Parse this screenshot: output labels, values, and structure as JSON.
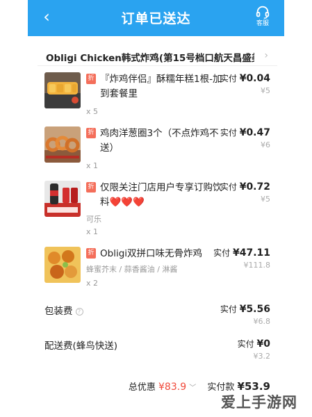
{
  "header": {
    "title": "订单已送达",
    "back_glyph": "‹",
    "service_label": "客服",
    "bg_color": "#2aa3f0"
  },
  "store": {
    "name": "Obligi Chicken韩式炸鸡(第15号档口航天昌盛美...",
    "chevron": "›"
  },
  "items": [
    {
      "discount_tag": "折",
      "name": "『炸鸡伴侣』酥糯年糕1根-加到套餐里",
      "spec": "",
      "qty": "x 5",
      "paid_label": "实付",
      "paid": "¥0.04",
      "original": "¥5"
    },
    {
      "discount_tag": "折",
      "name": "鸡肉洋葱圈3个（不点炸鸡不送）",
      "spec": "",
      "qty": "x 1",
      "paid_label": "实付",
      "paid": "¥0.47",
      "original": "¥6"
    },
    {
      "discount_tag": "折",
      "name": "仅限关注门店用户专享订购饮料❤️❤️❤️",
      "spec": "可乐",
      "qty": "x 1",
      "paid_label": "实付",
      "paid": "¥0.72",
      "original": "¥5"
    },
    {
      "discount_tag": "折",
      "name": "Obligi双拼口味无骨炸鸡",
      "spec": "蜂蜜芥末 / 蒜香酱油 / 淋酱",
      "qty": "x 2",
      "paid_label": "实付",
      "paid": "¥47.11",
      "original": "¥111.8"
    }
  ],
  "fees": [
    {
      "label": "包装费",
      "has_help": true,
      "paid_label": "实付",
      "paid": "¥5.56",
      "original": "¥6.8"
    },
    {
      "label": "配送费(蜂鸟快送)",
      "has_help": false,
      "paid_label": "实付",
      "paid": "¥0",
      "original": "¥3.2"
    }
  ],
  "summary": {
    "discount_label": "总优惠",
    "discount_value": "¥83.9",
    "paid_label": "实付款",
    "paid_value": "¥53.9"
  },
  "watermark": "爱上手游网",
  "colors": {
    "header": "#2aa3f0",
    "discount_tag": "#f46e5a",
    "discount_text": "#f0493a"
  },
  "icons": {
    "back": "chevron-left-icon",
    "service": "headset-icon",
    "help": "question-circle-icon",
    "expand": "chevron-down-icon"
  }
}
